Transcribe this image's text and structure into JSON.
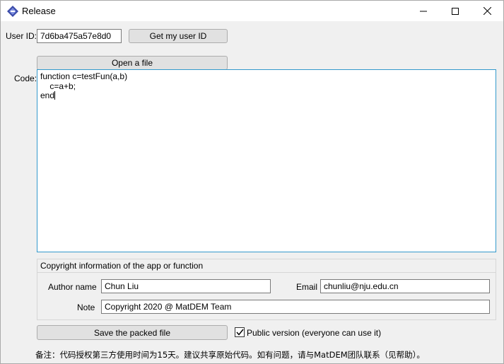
{
  "window": {
    "title": "Release"
  },
  "user_id": {
    "label": "User ID:",
    "value": "7d6ba475a57e8d0",
    "button_label": "Get my user ID"
  },
  "open_file_button": "Open a file",
  "code": {
    "label": "Code:",
    "lines": [
      "function c=testFun(a,b)",
      "    c=a+b;",
      "end"
    ]
  },
  "copyright": {
    "group_title": "Copyright information of the app or function",
    "author_label": "Author name",
    "author_value": "Chun Liu",
    "email_label": "Email",
    "email_value": "chunliu@nju.edu.cn",
    "note_label": "Note",
    "note_value": "Copyright 2020 @ MatDEM Team"
  },
  "save_button": "Save the packed file",
  "public_version": {
    "label": "Public version (everyone can use it)",
    "checked": true
  },
  "footer_note": "备注：代码授权第三方使用时间为15天。建议共享原始代码。如有问题，请与MatDEM团队联系（见帮助）。",
  "colors": {
    "focus_border": "#3399cc",
    "window_bg": "#f0f0f0"
  }
}
